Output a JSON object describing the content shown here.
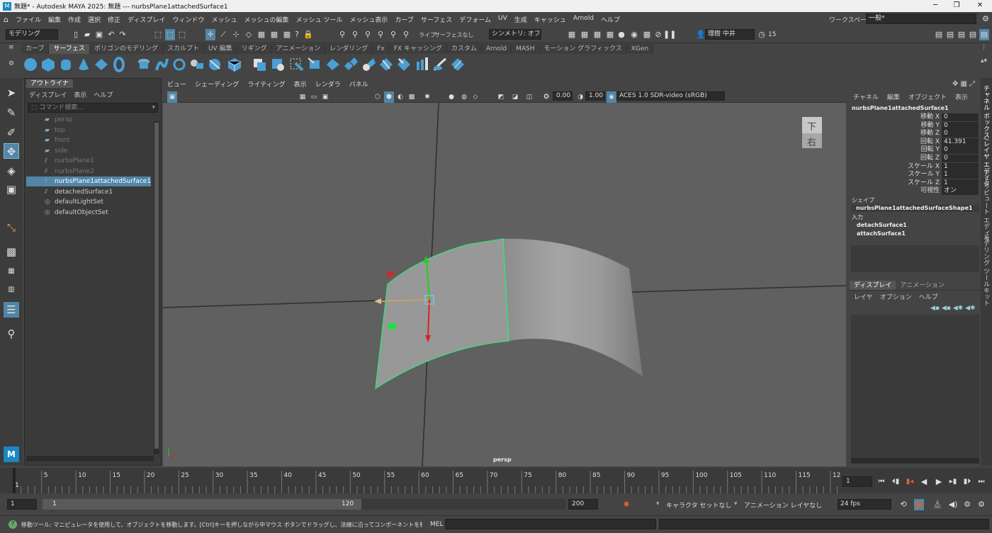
{
  "window": {
    "title": "無題* - Autodesk MAYA 2025: 無題   ---   nurbsPlane1attachedSurface1",
    "min": "─",
    "max": "❐",
    "close": "✕"
  },
  "menu": [
    "ファイル",
    "編集",
    "作成",
    "選択",
    "修正",
    "ディスプレイ",
    "ウィンドウ",
    "メッシュ",
    "メッシュの編集",
    "メッシュ ツール",
    "メッシュ表示",
    "カーブ",
    "サーフェス",
    "デフォーム",
    "UV",
    "生成",
    "キャッシュ",
    "Arnold",
    "ヘルプ"
  ],
  "workspace": {
    "label": "ワークスペース :",
    "value": "一般*"
  },
  "statusline": {
    "mode": "モデリング",
    "live": "ライブ",
    "live_value": "サーフェスなし",
    "symmetry": "シンメトリ: オフ",
    "user": "理樹 中井",
    "count": "15"
  },
  "shelf_tabs": [
    "カーブ",
    "サーフェス",
    "ポリゴンのモデリング",
    "スカルプト",
    "UV 編集",
    "リギング",
    "アニメーション",
    "レンダリング",
    "Fx",
    "FX キャッシング",
    "カスタム",
    "Arnold",
    "MASH",
    "モーション グラフィックス",
    "XGen"
  ],
  "outliner": {
    "tab": "アウトライナ",
    "menu": [
      "ディスプレイ",
      "表示",
      "ヘルプ"
    ],
    "search_placeholder": "コマンド検索...",
    "items": [
      "persp",
      "top",
      "front",
      "side",
      "nurbsPlane1",
      "nurbsPlane2",
      "nurbsPlane1attachedSurface1",
      "detachedSurface1",
      "defaultLightSet",
      "defaultObjectSet"
    ]
  },
  "viewport": {
    "menu": [
      "ビュー",
      "シェーディング",
      "ライティング",
      "表示",
      "レンダラ",
      "パネル"
    ],
    "exposure": "0.00",
    "gamma": "1.00",
    "colorspace": "ACES 1.0 SDR-video (sRGB)",
    "camera": "persp",
    "viewcube_top": "下",
    "viewcube_front": "右"
  },
  "channelbox": {
    "menu": [
      "チャネル",
      "編集",
      "オブジェクト",
      "表示"
    ],
    "object": "nurbsPlane1attachedSurface1",
    "channels": [
      {
        "name": "移動 X",
        "value": "0"
      },
      {
        "name": "移動 Y",
        "value": "0"
      },
      {
        "name": "移動 Z",
        "value": "0"
      },
      {
        "name": "回転 X",
        "value": "41.391"
      },
      {
        "name": "回転 Y",
        "value": "0"
      },
      {
        "name": "回転 Z",
        "value": "0"
      },
      {
        "name": "スケール X",
        "value": "1"
      },
      {
        "name": "スケール Y",
        "value": "1"
      },
      {
        "name": "スケール Z",
        "value": "1"
      },
      {
        "name": "可視性",
        "value": "オン"
      }
    ],
    "shape_header": "シェイプ",
    "shape": "nurbsPlane1attachedSurfaceShape1",
    "input_header": "入力",
    "inputs": [
      "detachSurface1",
      "attachSurface1"
    ]
  },
  "layers": {
    "tabs": [
      "ディスプレイ",
      "アニメーション"
    ],
    "menu": [
      "レイヤ",
      "オプション",
      "ヘルプ"
    ]
  },
  "sidetabs": [
    "チャネル ボックス/レイヤ エディタ",
    "アトリビュート エディタ",
    "モデリング ツールキット"
  ],
  "timeslider": {
    "ticks": [
      "5",
      "10",
      "15",
      "20",
      "25",
      "30",
      "35",
      "40",
      "45",
      "50",
      "55",
      "60",
      "65",
      "70",
      "75",
      "80",
      "85",
      "90",
      "95",
      "100",
      "105",
      "110",
      "115",
      "12"
    ],
    "start_marker": "1",
    "current": "1"
  },
  "range": {
    "start": "1",
    "inner_start": "1",
    "inner_end": "120",
    "end": "200",
    "character_set": "キャラクタ セットなし",
    "anim_layer": "アニメーション レイヤなし",
    "fps": "24 fps"
  },
  "help": {
    "text": "移動ツール: マニピュレータを使用して、オブジェクトを移動します。[Ctrl]キーを押しながら中マウス ボタンでドラッグし、法線に沿ってコンポーネントを移動します。[Shift]キーを押しながらマニ",
    "mel": "MEL"
  }
}
